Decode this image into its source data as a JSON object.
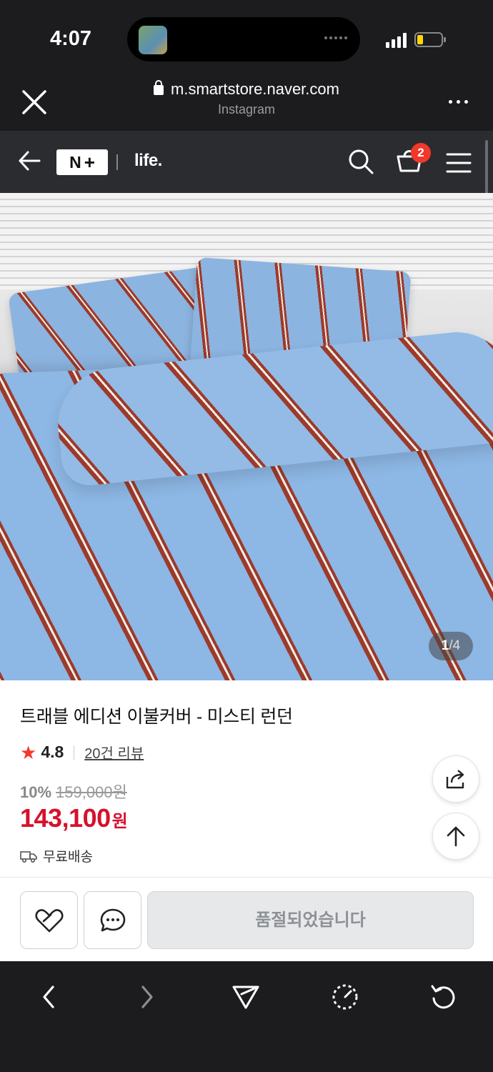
{
  "status_bar": {
    "time": "4:07"
  },
  "browser": {
    "url": "m.smartstore.naver.com",
    "source": "Instagram"
  },
  "site_header": {
    "logo_n": "N",
    "logo_plus": "+",
    "brand": "life.",
    "cart_count": "2"
  },
  "gallery": {
    "current": "1",
    "separator": "/",
    "total": "4"
  },
  "product": {
    "title": "트래블 에디션 이불커버 - 미스티 런던",
    "rating": "4.8",
    "reviews": "20건 리뷰",
    "discount": "10%",
    "original_price": "159,000원",
    "price": "143,100",
    "price_unit": "원",
    "shipping": "무료배송"
  },
  "actions": {
    "soldout_label": "품절되었습니다"
  },
  "colors": {
    "accent_red": "#d6112c",
    "badge_red": "#f2382a",
    "header_bg": "#2b2c2f"
  }
}
